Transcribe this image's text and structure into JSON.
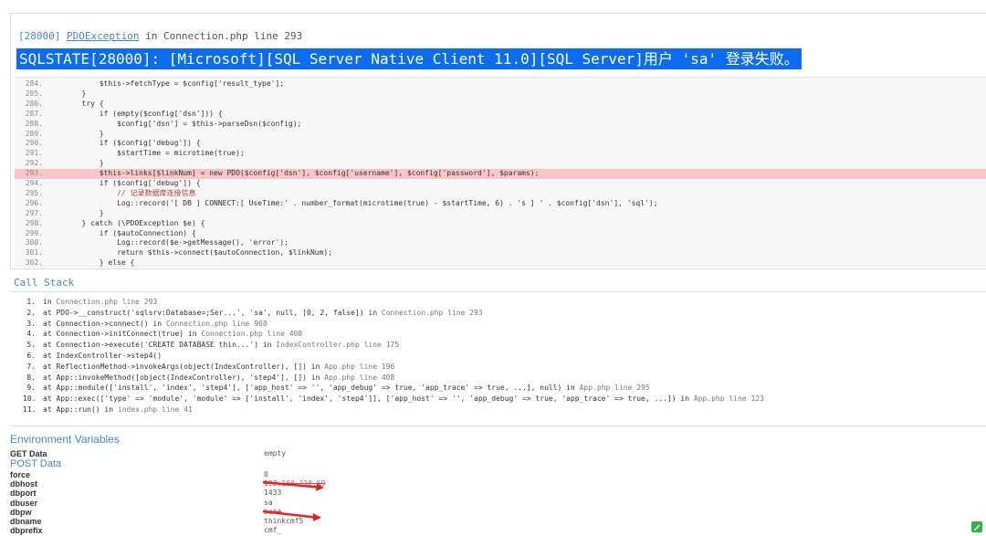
{
  "exception": {
    "code": "[28000]",
    "class": "PDOException",
    "location": "in Connection.php line 293",
    "message": "SQLSTATE[28000]: [Microsoft][SQL Server Native Client 11.0][SQL Server]用户 'sa' 登录失败。"
  },
  "source": {
    "highlight_line": "293.",
    "lines": [
      {
        "no": "284.",
        "code": "            $this->fetchType = $config['result_type'];"
      },
      {
        "no": "285.",
        "code": "        }"
      },
      {
        "no": "286.",
        "code": "        try {"
      },
      {
        "no": "287.",
        "code": "            if (empty($config['dsn'])) {"
      },
      {
        "no": "288.",
        "code": "                $config['dsn'] = $this->parseDsn($config);"
      },
      {
        "no": "289.",
        "code": "            }"
      },
      {
        "no": "290.",
        "code": "            if ($config['debug']) {"
      },
      {
        "no": "291.",
        "code": "                $startTime = microtime(true);"
      },
      {
        "no": "292.",
        "code": "            }"
      },
      {
        "no": "293.",
        "code": "            $this->links[$linkNum] = new PDO($config['dsn'], $config['username'], $config['password'], $params);"
      },
      {
        "no": "294.",
        "code": "            if ($config['debug']) {"
      },
      {
        "no": "295.",
        "code": "                // 记录数据库连接信息"
      },
      {
        "no": "296.",
        "code": "                Log::record('[ DB ] CONNECT:[ UseTime:' . number_format(microtime(true) - $startTime, 6) . 's ] ' . $config['dsn'], 'sql');"
      },
      {
        "no": "297.",
        "code": "            }"
      },
      {
        "no": "298.",
        "code": "        } catch (\\PDOException $e) {"
      },
      {
        "no": "299.",
        "code": "            if ($autoConnection) {"
      },
      {
        "no": "300.",
        "code": "                Log::record($e->getMessage(), 'error');"
      },
      {
        "no": "301.",
        "code": "                return $this->connect($autoConnection, $linkNum);"
      },
      {
        "no": "302.",
        "code": "            } else {"
      }
    ]
  },
  "call_stack": {
    "title": "Call Stack",
    "items": [
      {
        "no": "1.",
        "text": "in ",
        "file": "Connection.php line 293"
      },
      {
        "no": "2.",
        "text": "at PDO->__construct('sqlsrv:Database=;Ser...', 'sa', null, [0, 2, false]) in ",
        "file": "Connection.php line 293"
      },
      {
        "no": "3.",
        "text": "at Connection->connect() in ",
        "file": "Connection.php line 968"
      },
      {
        "no": "4.",
        "text": "at Connection->initConnect(true) in ",
        "file": "Connection.php line 408"
      },
      {
        "no": "5.",
        "text": "at Connection->execute('CREATE DATABASE thin...') in ",
        "file": "IndexController.php line 175"
      },
      {
        "no": "6.",
        "text": "at IndexController->step4()",
        "file": ""
      },
      {
        "no": "7.",
        "text": "at ReflectionMethod->invokeArgs(object(IndexController), []) in ",
        "file": "App.php line 196"
      },
      {
        "no": "8.",
        "text": "at App::invokeMethod([object(IndexController), 'step4'], []) in ",
        "file": "App.php line 408"
      },
      {
        "no": "9.",
        "text": "at App::module(['install', 'index', 'step4'], ['app_host' => '', 'app_debug' => true, 'app_trace' => true, ...], null) in ",
        "file": "App.php line 295"
      },
      {
        "no": "10.",
        "text": "at App::exec(['type' => 'module', 'module' => ['install', 'index', 'step4']], ['app_host' => '', 'app_debug' => true, 'app_trace' => true, ...]) in ",
        "file": "App.php line 123"
      },
      {
        "no": "11.",
        "text": "at App::run() in ",
        "file": "index.php line 41"
      }
    ]
  },
  "env": {
    "title": "Environment Variables",
    "get_label": "GET Data",
    "get_value": "empty",
    "post_label": "POST Data",
    "rows": [
      {
        "key": "force",
        "value": "0"
      },
      {
        "key": "dbhost",
        "value": "192.168.210.59"
      },
      {
        "key": "dbport",
        "value": "1433"
      },
      {
        "key": "dbuser",
        "value": "sa"
      },
      {
        "key": "dbpw",
        "value": "be**"
      },
      {
        "key": "dbname",
        "value": "thinkcmf5"
      },
      {
        "key": "dbprefix",
        "value": "cmf_"
      }
    ]
  },
  "colors": {
    "accent": "#4288ce",
    "highlight": "#f9c6c3",
    "message_bg": "#0c6cf0",
    "annotation": "#e8202a"
  }
}
